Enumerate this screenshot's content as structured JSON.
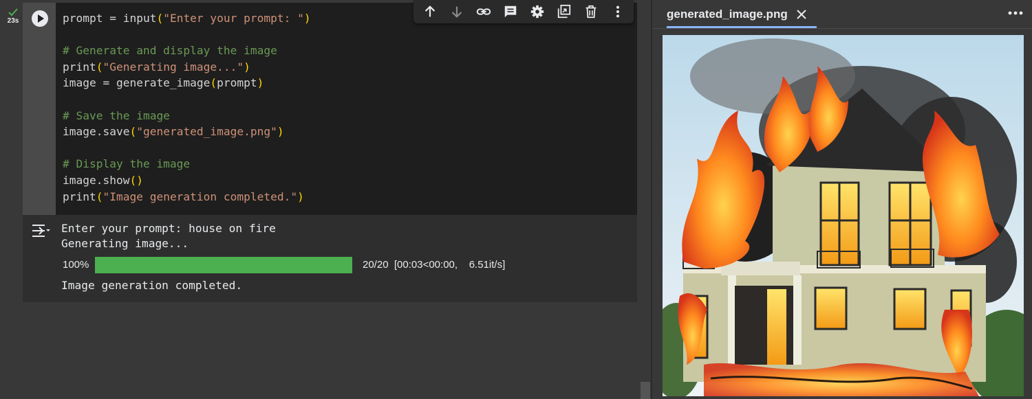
{
  "cell": {
    "exec_time": "23s",
    "code_lines": [
      [
        {
          "t": "prompt = ",
          "c": "plain"
        },
        {
          "t": "input",
          "c": "plain"
        },
        {
          "t": "(",
          "c": "paren"
        },
        {
          "t": "\"Enter your prompt: \"",
          "c": "str"
        },
        {
          "t": ")",
          "c": "paren"
        }
      ],
      [],
      [
        {
          "t": "# Generate and display the image",
          "c": "cmt"
        }
      ],
      [
        {
          "t": "print",
          "c": "plain"
        },
        {
          "t": "(",
          "c": "paren"
        },
        {
          "t": "\"Generating image...\"",
          "c": "str"
        },
        {
          "t": ")",
          "c": "paren"
        }
      ],
      [
        {
          "t": "image = generate_image",
          "c": "plain"
        },
        {
          "t": "(",
          "c": "paren"
        },
        {
          "t": "prompt",
          "c": "plain"
        },
        {
          "t": ")",
          "c": "paren"
        }
      ],
      [],
      [
        {
          "t": "# Save the image",
          "c": "cmt"
        }
      ],
      [
        {
          "t": "image.save",
          "c": "plain"
        },
        {
          "t": "(",
          "c": "paren"
        },
        {
          "t": "\"generated_image.png\"",
          "c": "str"
        },
        {
          "t": ")",
          "c": "paren"
        }
      ],
      [],
      [
        {
          "t": "# Display the image",
          "c": "cmt"
        }
      ],
      [
        {
          "t": "image.show",
          "c": "plain"
        },
        {
          "t": "()",
          "c": "paren"
        }
      ],
      [
        {
          "t": "print",
          "c": "plain"
        },
        {
          "t": "(",
          "c": "paren"
        },
        {
          "t": "\"Image generation completed.\"",
          "c": "str"
        },
        {
          "t": ")",
          "c": "paren"
        }
      ]
    ]
  },
  "toolbar": {
    "icons": [
      "arrow-up-icon",
      "arrow-down-icon",
      "link-icon",
      "comment-icon",
      "gear-icon",
      "mirror-cell-icon",
      "trash-icon",
      "more-vert-icon"
    ]
  },
  "output": {
    "line1": "Enter your prompt: house on fire",
    "line2": "Generating image...",
    "progress_percent_text": "100%",
    "progress_fraction": 1.0,
    "progress_stats": "20/20  [00:03<00:00,    6.51it/s]",
    "line3": "Image generation completed."
  },
  "viewer": {
    "tab_label": "generated_image.png"
  },
  "colors": {
    "progress": "#4caf50",
    "tab_accent": "#8ab4f8",
    "check": "#4caf50"
  }
}
